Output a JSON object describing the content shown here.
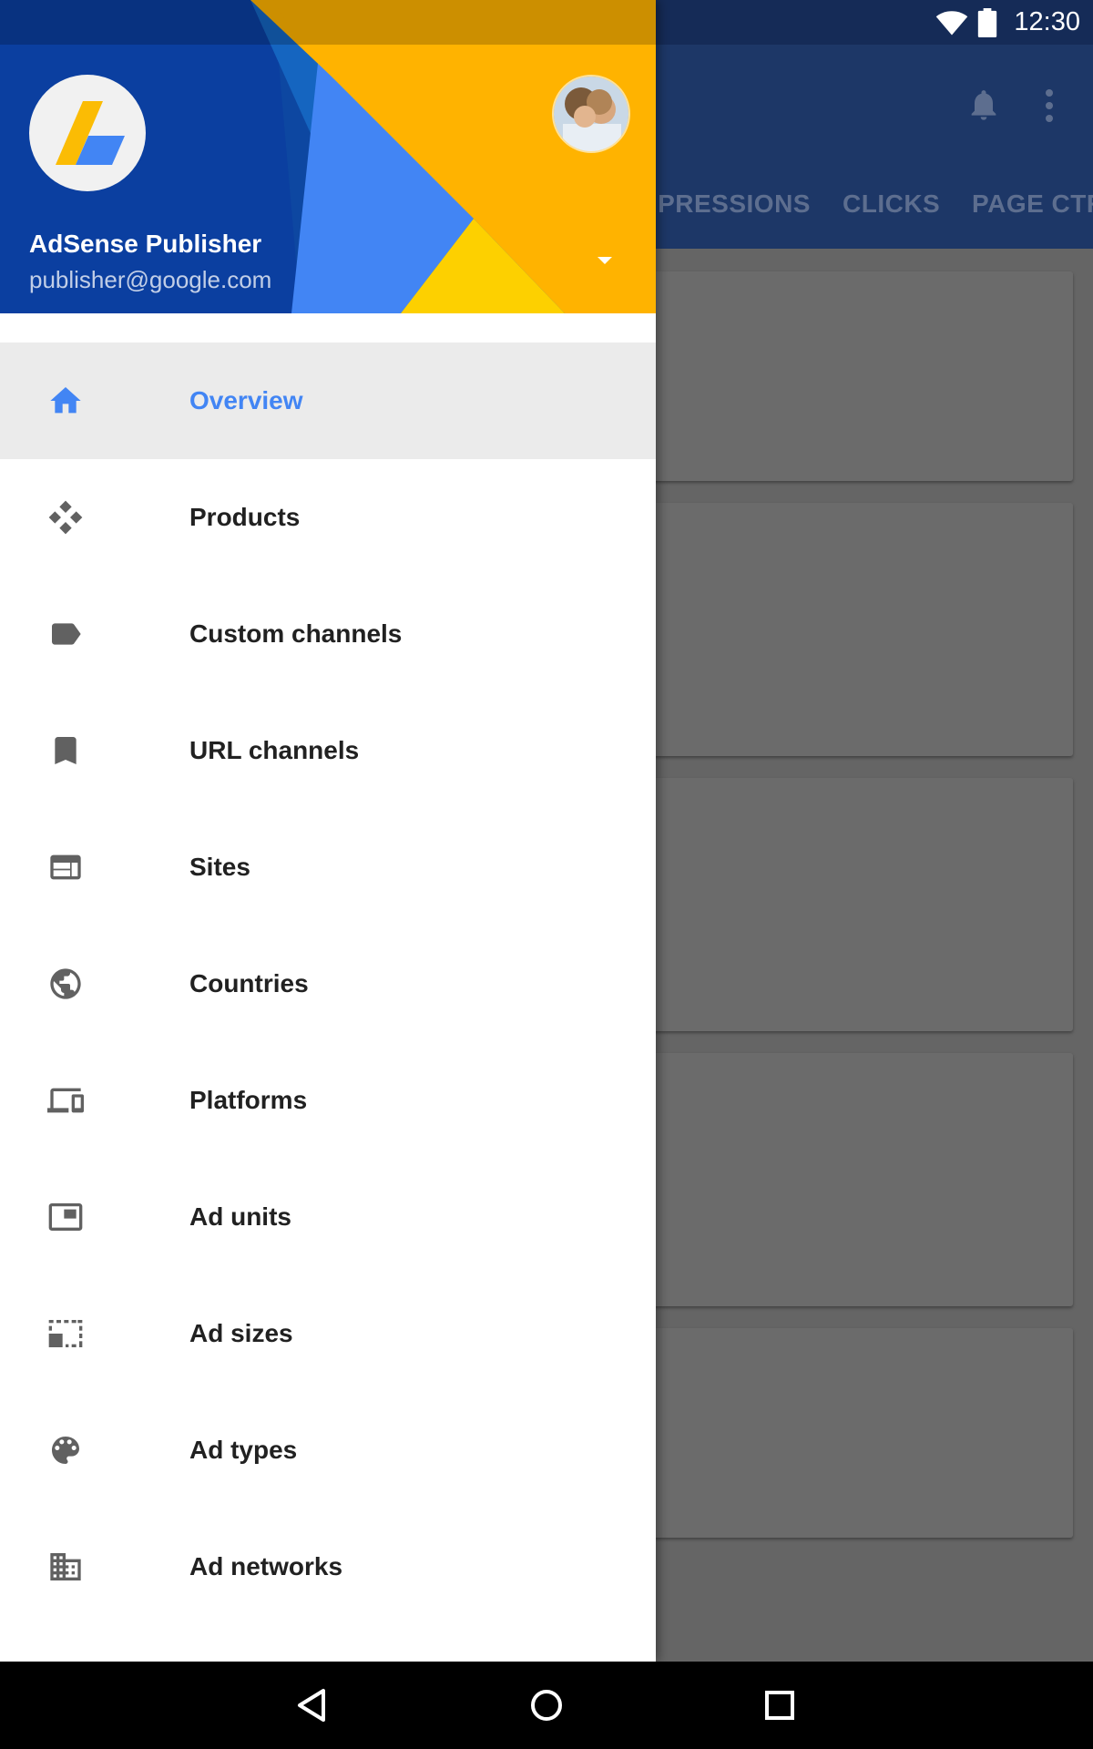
{
  "status_bar": {
    "time": "12:30"
  },
  "background_app": {
    "tabs": [
      {
        "label": "IMPRESSIONS"
      },
      {
        "label": "CLICKS"
      },
      {
        "label": "PAGE CTR"
      }
    ]
  },
  "drawer": {
    "account": {
      "name": "AdSense Publisher",
      "email": "publisher@google.com"
    },
    "items": [
      {
        "label": "Overview",
        "icon": "home-icon",
        "active": true
      },
      {
        "label": "Products",
        "icon": "products-icon",
        "active": false
      },
      {
        "label": "Custom channels",
        "icon": "label-icon",
        "active": false
      },
      {
        "label": "URL channels",
        "icon": "bookmark-icon",
        "active": false
      },
      {
        "label": "Sites",
        "icon": "web-icon",
        "active": false
      },
      {
        "label": "Countries",
        "icon": "globe-icon",
        "active": false
      },
      {
        "label": "Platforms",
        "icon": "devices-icon",
        "active": false
      },
      {
        "label": "Ad units",
        "icon": "picture-in-picture-icon",
        "active": false
      },
      {
        "label": "Ad sizes",
        "icon": "selection-icon",
        "active": false
      },
      {
        "label": "Ad types",
        "icon": "palette-icon",
        "active": false
      },
      {
        "label": "Ad networks",
        "icon": "business-icon",
        "active": false
      }
    ]
  },
  "colors": {
    "accent": "#4285f4",
    "header_blue": "#0d47a1",
    "header_yellow": "#fbbc04",
    "icon_gray": "#616161"
  }
}
